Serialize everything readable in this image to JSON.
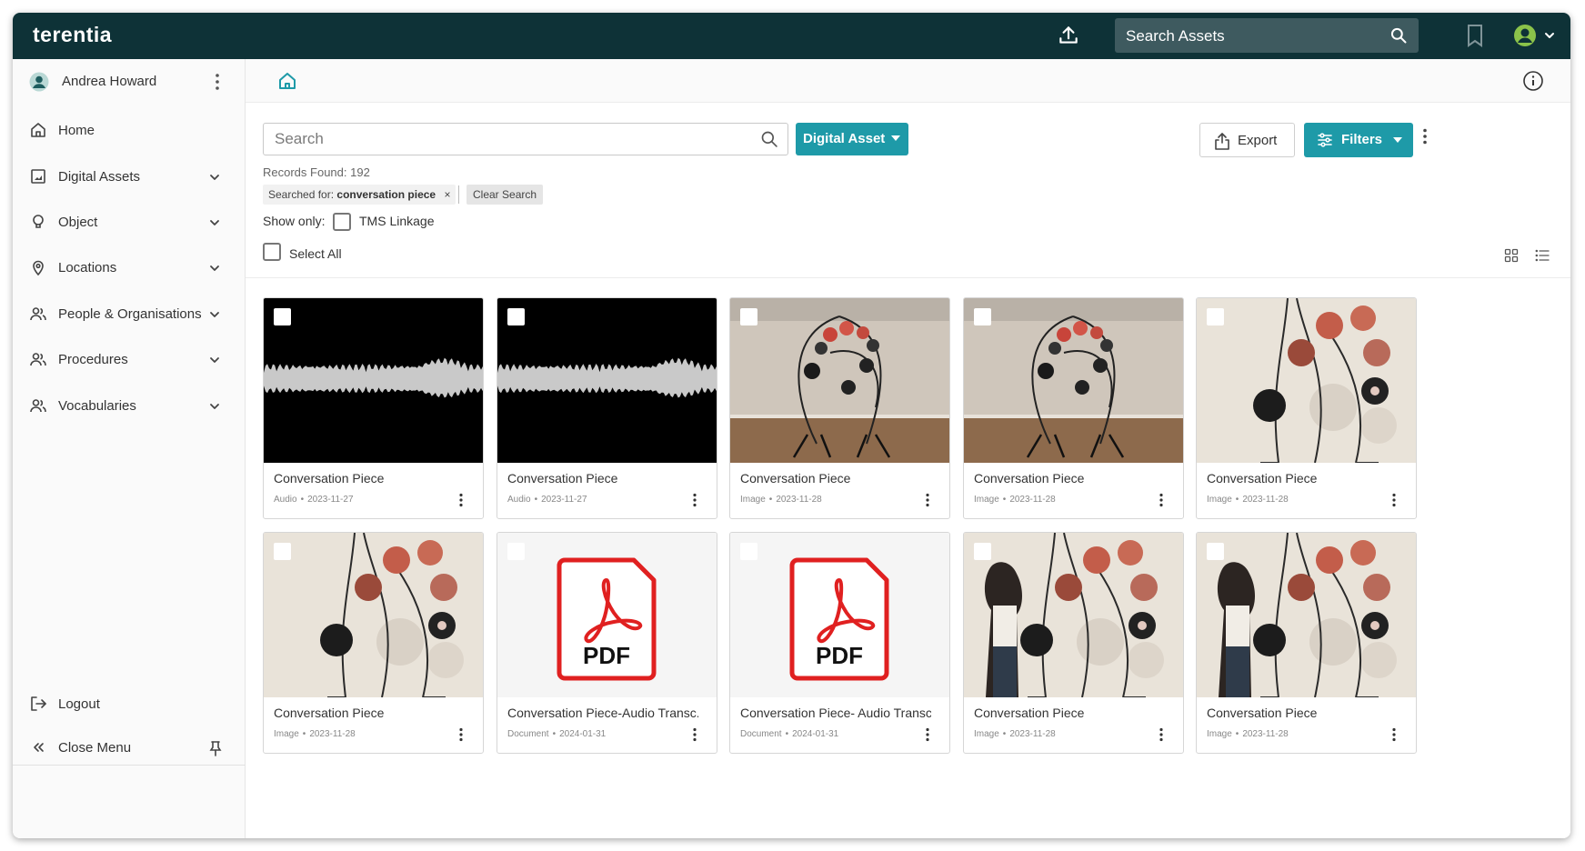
{
  "app": {
    "brand": "terentia"
  },
  "topbar": {
    "search_placeholder": "Search Assets"
  },
  "user": {
    "name": "Andrea Howard"
  },
  "sidebar": {
    "items": [
      {
        "label": "Home",
        "icon": "home-icon",
        "chevron": false
      },
      {
        "label": "Digital Assets",
        "icon": "image-icon",
        "chevron": true
      },
      {
        "label": "Object",
        "icon": "lightbulb-icon",
        "chevron": true
      },
      {
        "label": "Locations",
        "icon": "map-pin-icon",
        "chevron": true
      },
      {
        "label": "People & Organisations",
        "icon": "people-icon",
        "chevron": true
      },
      {
        "label": "Procedures",
        "icon": "people-icon",
        "chevron": true
      },
      {
        "label": "Vocabularies",
        "icon": "people-icon",
        "chevron": true
      }
    ],
    "logout": "Logout",
    "close_menu": "Close Menu"
  },
  "toolbar": {
    "search_placeholder": "Search",
    "asset_type": "Digital Asset",
    "export_label": "Export",
    "filters_label": "Filters"
  },
  "results": {
    "records_label": "Records Found:",
    "records_count": "192",
    "searched_for_label": "Searched for:",
    "searched_for_term": "conversation piece",
    "clear_search": "Clear Search",
    "show_only_label": "Show only:",
    "tms_linkage": "TMS Linkage",
    "select_all": "Select All"
  },
  "cards": [
    {
      "title": "Conversation Piece",
      "type": "Audio",
      "date": "2023-11-27",
      "thumb": "audio"
    },
    {
      "title": "Conversation Piece",
      "type": "Audio",
      "date": "2023-11-27",
      "thumb": "audio"
    },
    {
      "title": "Conversation Piece",
      "type": "Image",
      "date": "2023-11-28",
      "thumb": "room"
    },
    {
      "title": "Conversation Piece",
      "type": "Image",
      "date": "2023-11-28",
      "thumb": "room"
    },
    {
      "title": "Conversation Piece",
      "type": "Image",
      "date": "2023-11-28",
      "thumb": "sculpture"
    },
    {
      "title": "Conversation Piece",
      "type": "Image",
      "date": "2023-11-28",
      "thumb": "sculpture"
    },
    {
      "title": "Conversation Piece-Audio Transc...",
      "type": "Document",
      "date": "2024-01-31",
      "thumb": "pdf"
    },
    {
      "title": "Conversation Piece- Audio Transc...",
      "type": "Document",
      "date": "2024-01-31",
      "thumb": "pdf"
    },
    {
      "title": "Conversation Piece",
      "type": "Image",
      "date": "2023-11-28",
      "thumb": "person"
    },
    {
      "title": "Conversation Piece",
      "type": "Image",
      "date": "2023-11-28",
      "thumb": "person"
    }
  ],
  "pdf_badge": "PDF",
  "colors": {
    "topbar": "#0e3237",
    "accent": "#1e9aa8",
    "pdf_red": "#e02020"
  }
}
